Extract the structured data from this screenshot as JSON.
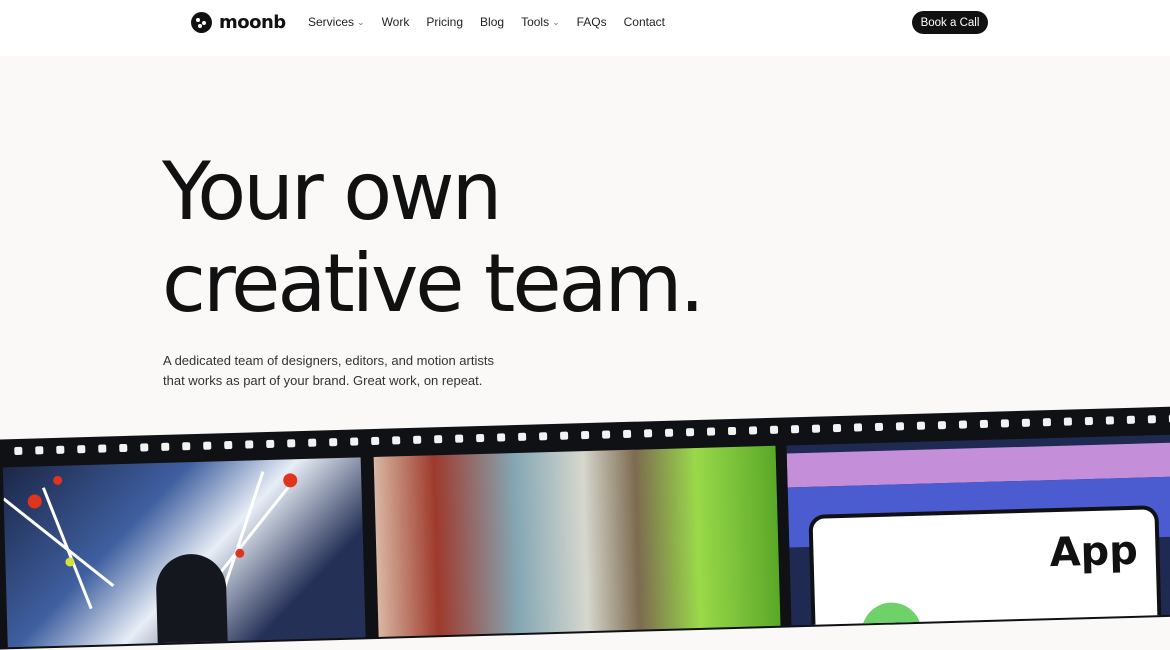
{
  "nav": {
    "logo_text": "moonb",
    "menu": [
      {
        "label": "Services",
        "dropdown": true
      },
      {
        "label": "Work",
        "dropdown": false
      },
      {
        "label": "Pricing",
        "dropdown": false
      },
      {
        "label": "Blog",
        "dropdown": false
      },
      {
        "label": "Tools",
        "dropdown": true
      },
      {
        "label": "FAQs",
        "dropdown": false
      },
      {
        "label": "Contact",
        "dropdown": false
      }
    ],
    "cta_label": "Book a Call"
  },
  "hero": {
    "title_line1": "Your own",
    "title_line2": "creative team.",
    "subtitle_line1": "A dedicated team of designers, editors, and motion artists",
    "subtitle_line2": "that works as part of your brand. Great work, on repeat."
  },
  "film_strip": {
    "frame3_text": "App"
  },
  "colors": {
    "page_bg": "#faf9f7",
    "nav_bg": "#ffffff",
    "text_dark": "#111111",
    "cta_bg": "#111111",
    "strip_bg": "#0f1115"
  }
}
